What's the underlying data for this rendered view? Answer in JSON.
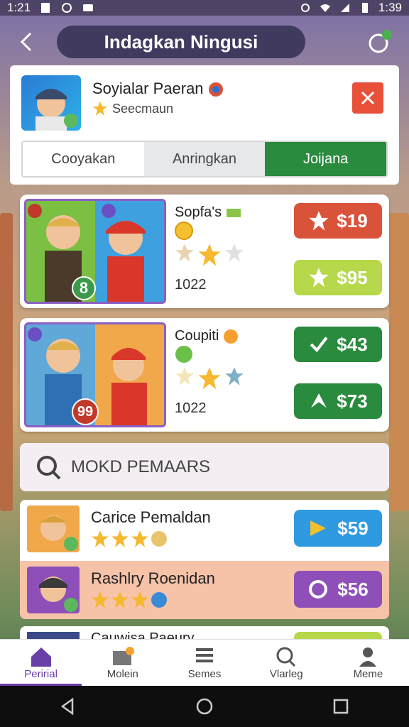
{
  "status_bar": {
    "time_left": "1:21",
    "time_right": "1:39"
  },
  "header": {
    "title": "Indagkan Ningusi"
  },
  "profile": {
    "name": "Soyialar Paeran",
    "subtitle": "Seecmaun"
  },
  "tabs": [
    {
      "label": "Cooyakan",
      "active": false
    },
    {
      "label": "Anringkan",
      "active": false
    },
    {
      "label": "Joijana",
      "active": true
    }
  ],
  "offers": [
    {
      "title": "Sopfa's",
      "jersey_number": "8",
      "count": "1022",
      "rating": 2,
      "buttons": [
        {
          "price": "$19",
          "color": "#d9533a"
        },
        {
          "price": "$95",
          "color": "#b7d84a"
        }
      ]
    },
    {
      "title": "Coupiti",
      "jersey_number": "99",
      "count": "1022",
      "rating": 2,
      "buttons": [
        {
          "price": "$43",
          "color": "#2a8a3e"
        },
        {
          "price": "$73",
          "color": "#2a8a3e"
        }
      ]
    }
  ],
  "section": {
    "title": "MOKD PEMAARS"
  },
  "list": [
    {
      "name": "Carice Pemaldan",
      "price": "$59",
      "color": "#2f9ae0",
      "rating": 3
    },
    {
      "name": "Rashlry Roenidan",
      "price": "$56",
      "color": "#8e4fb8",
      "rating": 3
    }
  ],
  "partial_row": {
    "name": "Cauwisa Paeury"
  },
  "bottom_nav": [
    {
      "label": "Peririal",
      "icon": "home-icon",
      "active": true
    },
    {
      "label": "Molein",
      "icon": "edit-icon",
      "active": false
    },
    {
      "label": "Semes",
      "icon": "list-icon",
      "active": false
    },
    {
      "label": "Vlarleg",
      "icon": "search-icon",
      "active": false
    },
    {
      "label": "Meme",
      "icon": "profile-icon",
      "active": false
    }
  ],
  "colors": {
    "accent_purple": "#6a3fa8",
    "green": "#2a8a3e",
    "red": "#e8503a"
  }
}
